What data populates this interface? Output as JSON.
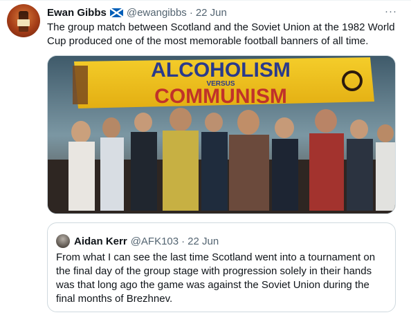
{
  "tweet": {
    "author_name": "Ewan Gibbs",
    "author_flag_icon": "scotland-flag-icon",
    "author_handle": "@ewangibbs",
    "separator": "·",
    "date": "22 Jun",
    "more_icon": "more-horizontal-icon",
    "more_glyph": "···",
    "text": "The group match between Scotland and the Soviet Union at the 1982 World Cup produced one of the most memorable football banners of all time.",
    "media": {
      "banner_line1": "ALCOHOLISM",
      "banner_versus": "VERSUS",
      "banner_line2": "COMMUNISM",
      "banner_color": "#f2c21b",
      "banner_text_color": "#c0322a"
    }
  },
  "quoted_tweet": {
    "author_name": "Aidan Kerr",
    "author_handle": "@AFK103",
    "separator": "·",
    "date": "22 Jun",
    "text": "From what I can see the last time Scotland went into a tournament on the final day of the group stage with progression solely in their hands was that long ago the game was against the Soviet Union during the final months of Brezhnev."
  },
  "colors": {
    "text_primary": "#0f1419",
    "text_secondary": "#536471",
    "border": "#cfd9de",
    "scotland_blue": "#005eb8"
  }
}
